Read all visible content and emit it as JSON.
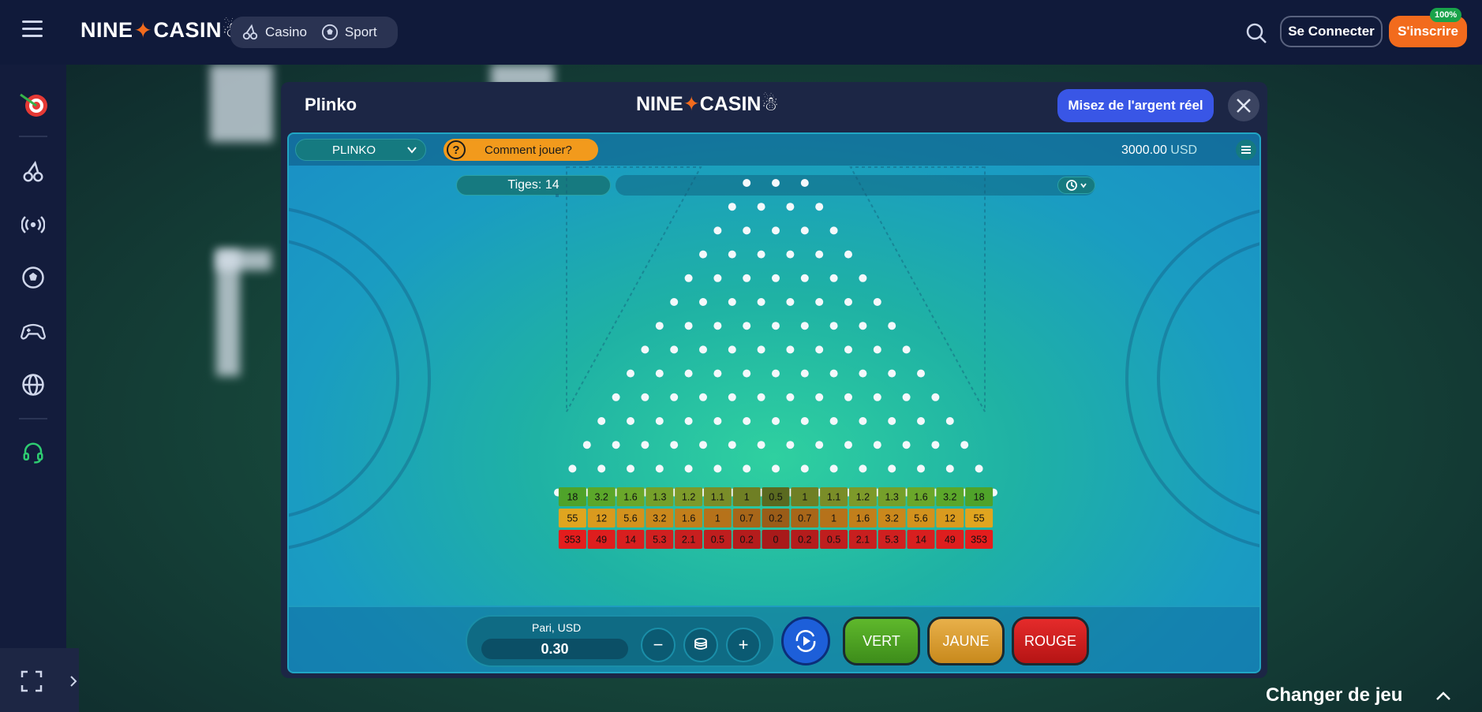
{
  "header": {
    "logo_left": "NINE",
    "logo_right": "CASIN",
    "nav": [
      {
        "label": "Casino",
        "icon": "cherry-icon"
      },
      {
        "label": "Sport",
        "icon": "soccer-ball-icon"
      }
    ],
    "login_label": "Se Connecter",
    "signup_label": "S'inscrire",
    "signup_badge": "100%"
  },
  "sidebar": {
    "icons": [
      "dart-target-icon",
      "cherry-icon",
      "live-broadcast-icon",
      "soccer-ball-icon",
      "gamepad-icon",
      "globe-icon",
      "headset-icon"
    ]
  },
  "modal": {
    "title": "Plinko",
    "logo_left": "NINE",
    "logo_right": "CASIN",
    "real_money_label": "Misez de l'argent réel"
  },
  "game": {
    "game_select": "PLINKO",
    "how_to_label": "Comment jouer?",
    "how_to_icon": "?",
    "balance_value": "3000.00",
    "balance_currency": "USD",
    "pegs_label": "Tiges: 14",
    "rows": 14,
    "multipliers": {
      "green": [
        "18",
        "3.2",
        "1.6",
        "1.3",
        "1.2",
        "1.1",
        "1",
        "0.5",
        "1",
        "1.1",
        "1.2",
        "1.3",
        "1.6",
        "3.2",
        "18"
      ],
      "yellow": [
        "55",
        "12",
        "5.6",
        "3.2",
        "1.6",
        "1",
        "0.7",
        "0.2",
        "0.7",
        "1",
        "1.6",
        "3.2",
        "5.6",
        "12",
        "55"
      ],
      "red": [
        "353",
        "49",
        "14",
        "5.3",
        "2.1",
        "0.5",
        "0.2",
        "0",
        "0.2",
        "0.5",
        "2.1",
        "5.3",
        "14",
        "49",
        "353"
      ]
    },
    "bet_label": "Pari, USD",
    "bet_value": "0.30",
    "minus_label": "−",
    "plus_label": "+",
    "buttons": {
      "green": "VERT",
      "yellow": "JAUNE",
      "red": "ROUGE"
    }
  },
  "footer": {
    "change_game_label": "Changer de jeu"
  },
  "colors": {
    "accent_orange": "#f26b1d",
    "real_money_blue": "#3956e6",
    "green_row": "#5ba72a",
    "yellow_row": "#e0a51f",
    "red_row": "#d62828"
  }
}
